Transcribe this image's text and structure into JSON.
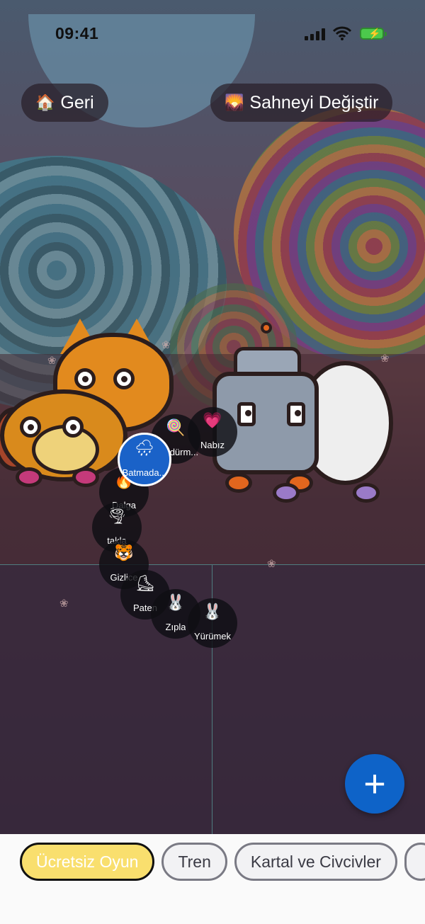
{
  "status": {
    "time": "09:41",
    "battery_icon": "battery-charging-icon",
    "wifi_icon": "wifi-icon",
    "signal_icon": "signal-icon"
  },
  "header": {
    "back": {
      "icon": "🏠",
      "label": "Geri"
    },
    "change_scene": {
      "icon": "🌄",
      "label": "Sahneyi Değiştir"
    }
  },
  "actions": [
    {
      "icon": "🌧",
      "label": "Batmada..."
    },
    {
      "icon": "🍭",
      "label": "Döndürm..."
    },
    {
      "icon": "💗",
      "label": "Nabız"
    },
    {
      "icon": "🔥",
      "label": "Dalga"
    },
    {
      "icon": "🌪",
      "label": "takla"
    },
    {
      "icon": "🐯",
      "label": "Gizlice"
    },
    {
      "icon": "⛸",
      "label": "Paten"
    },
    {
      "icon": "🐰",
      "label": "Zıpla"
    },
    {
      "icon": "🐰",
      "label": "Yürümek"
    }
  ],
  "fab": {
    "label": "+"
  },
  "categories": [
    {
      "label": "Ücretsiz Oyun",
      "selected": true
    },
    {
      "label": "Tren",
      "selected": false
    },
    {
      "label": "Kartal ve Civcivler",
      "selected": false
    },
    {
      "label": "",
      "selected": false
    }
  ],
  "colors": {
    "accent": "#0e63c8",
    "selected_chip": "#f9df6e"
  }
}
